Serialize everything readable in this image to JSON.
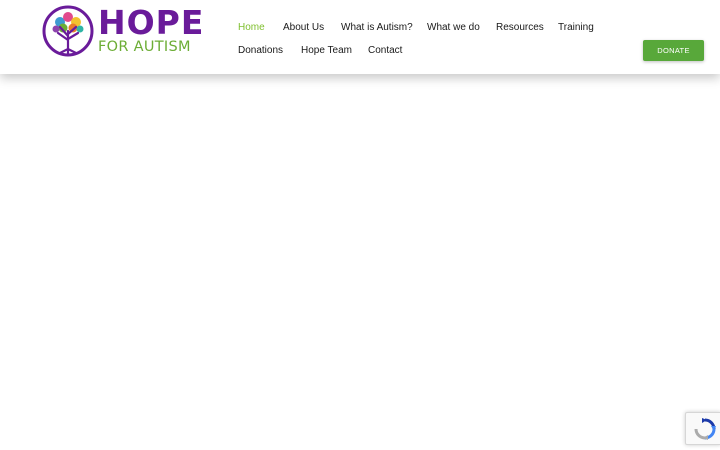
{
  "header": {
    "logo": {
      "line1": "HOPE",
      "line2": "FOR AUTISM"
    },
    "nav": [
      {
        "label": "Home",
        "active": true
      },
      {
        "label": "About Us"
      },
      {
        "label": "What is Autism?"
      },
      {
        "label": "What we do"
      },
      {
        "label": "Resources"
      },
      {
        "label": "Training"
      },
      {
        "label": "Donations"
      },
      {
        "label": "Hope Team"
      },
      {
        "label": "Contact"
      }
    ],
    "donate_label": "DONATE"
  },
  "colors": {
    "brand_purple": "#6a1b9a",
    "brand_green": "#6cad35",
    "nav_active": "#7fbf2e",
    "donate_bg": "#58a83a"
  },
  "icons": {
    "recaptcha": "recaptcha-icon"
  }
}
